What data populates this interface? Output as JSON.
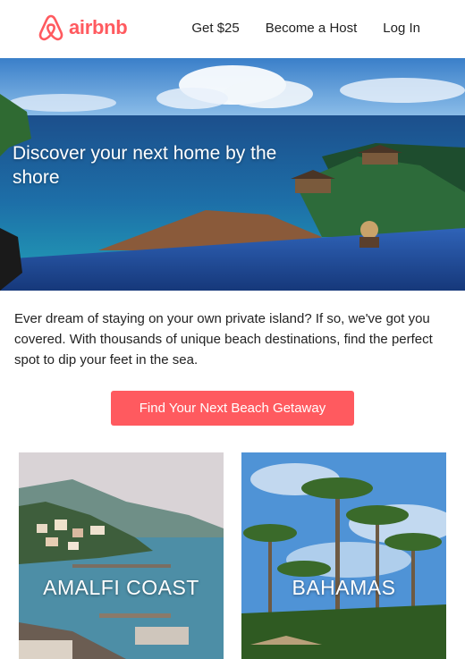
{
  "brand": {
    "name": "airbnb",
    "color": "#ff5a5f"
  },
  "nav": {
    "items": [
      "Get $25",
      "Become a Host",
      "Log In"
    ]
  },
  "hero": {
    "heading": "Discover your next home by the shore"
  },
  "intro": {
    "text": "Ever dream of staying on your own private island? If so, we've got you covered. With thousands of unique beach destinations, find the perfect spot to dip your feet in the sea."
  },
  "cta": {
    "label": "Find Your Next Beach Getaway",
    "color": "#ff5a5f"
  },
  "destinations": [
    {
      "name": "AMALFI COAST"
    },
    {
      "name": "BAHAMAS"
    }
  ]
}
